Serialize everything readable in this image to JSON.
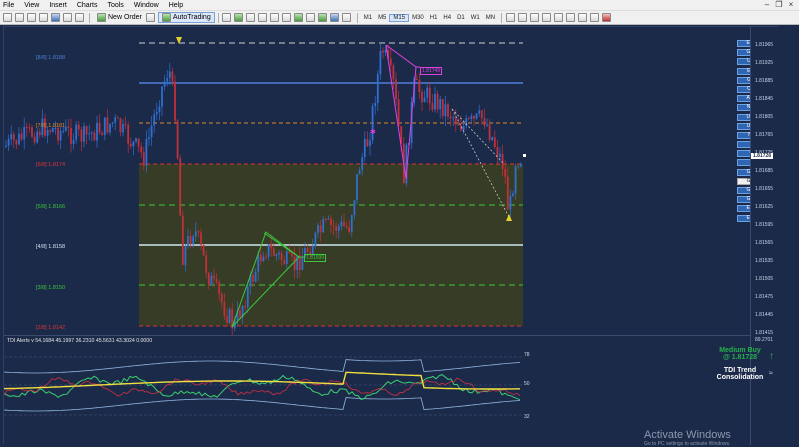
{
  "menu": [
    "File",
    "View",
    "Insert",
    "Charts",
    "Tools",
    "Window",
    "Help"
  ],
  "toolbar": {
    "new_order": "New Order",
    "autotrading": "AutoTrading",
    "timeframes": [
      "M1",
      "M5",
      "M15",
      "M30",
      "H1",
      "H4",
      "D1",
      "W1",
      "MN"
    ],
    "active_tf": "M15"
  },
  "pairs": [
    "EURUSD",
    "GBPUSD",
    "USDJPY",
    "EURJPY",
    "GBPJPY",
    "CADJPY",
    "AUDUSD",
    "NZDUSD",
    "USDCAD",
    "USDCHF",
    "NAUSD",
    "HK50",
    "UK100",
    "US30",
    "GBPNZD",
    "GBPAUD",
    "GBPCAD",
    "GBPCHF",
    "EURAUD",
    "EURGBP"
  ],
  "selected_pair": "GBPAUD",
  "price_axis": [
    "1.81965",
    "1.81925",
    "1.81885",
    "1.81845",
    "1.81805",
    "1.81765",
    "1.81725",
    "1.81685",
    "1.81655",
    "1.81625",
    "1.81595",
    "1.81565",
    "1.81535",
    "1.81505",
    "1.81475",
    "1.81445",
    "1.81415"
  ],
  "current_price": "1.81728",
  "fib_levels": [
    {
      "label": "[8/8]",
      "price": "1.8188",
      "color": "#4d7fd6"
    },
    {
      "label": "[7/8]",
      "price": "1.8181",
      "color": "#e08a2c"
    },
    {
      "label": "[6/8]",
      "price": "1.8174",
      "color": "#d33"
    },
    {
      "label": "[5/8]",
      "price": "1.8166",
      "color": "#3cc83c"
    },
    {
      "label": "[4/8]",
      "price": "1.8158",
      "color": "#cfe6f2"
    },
    {
      "label": "[3/8]",
      "price": "1.8150",
      "color": "#3cc83c"
    },
    {
      "label": "[2/8]",
      "price": "1.8142",
      "color": "#d33"
    }
  ],
  "pattern_tags": {
    "top": "1.81749",
    "bottom": "1.81599"
  },
  "indicator": {
    "title": "TDI Alerts v 54.1684 45.1997 36.2310 45.5631 43.3024 0.0000",
    "levels": [
      "78",
      "50",
      "32"
    ],
    "axis_top": "89.2701"
  },
  "signals": {
    "line1": "Medium Buy",
    "line2": "@ 1.81728",
    "trend_title": "TDI Trend",
    "trend_state": "Consolidation"
  },
  "watermark": {
    "title": "Activate Windows",
    "sub": "Go to PC settings to activate Windows."
  },
  "colors": {
    "bg": "#1c2a4a",
    "bull": "#2f6fd0",
    "bear": "#c2303a",
    "zone": "#3b3f1f",
    "accent_buy": "#22b14c"
  }
}
